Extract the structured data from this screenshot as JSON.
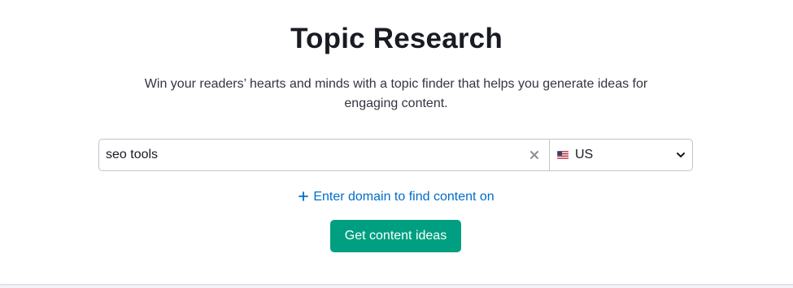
{
  "page": {
    "title": "Topic Research",
    "subtitle": "Win your readers’ hearts and minds with a topic finder that helps you generate ideas for engaging content."
  },
  "search": {
    "value": "seo tools",
    "clear_icon": "close-icon"
  },
  "database": {
    "flag_icon": "us-flag-icon",
    "selected": "US",
    "dropdown_icon": "chevron-down-icon"
  },
  "domain_link": {
    "icon": "plus-icon",
    "label": "Enter domain to find content on"
  },
  "cta": {
    "label": "Get content ideas"
  },
  "colors": {
    "title": "#191b23",
    "link": "#006dca",
    "button": "#009f81",
    "border": "#c2c4cc",
    "background": "#f4f5f9"
  }
}
